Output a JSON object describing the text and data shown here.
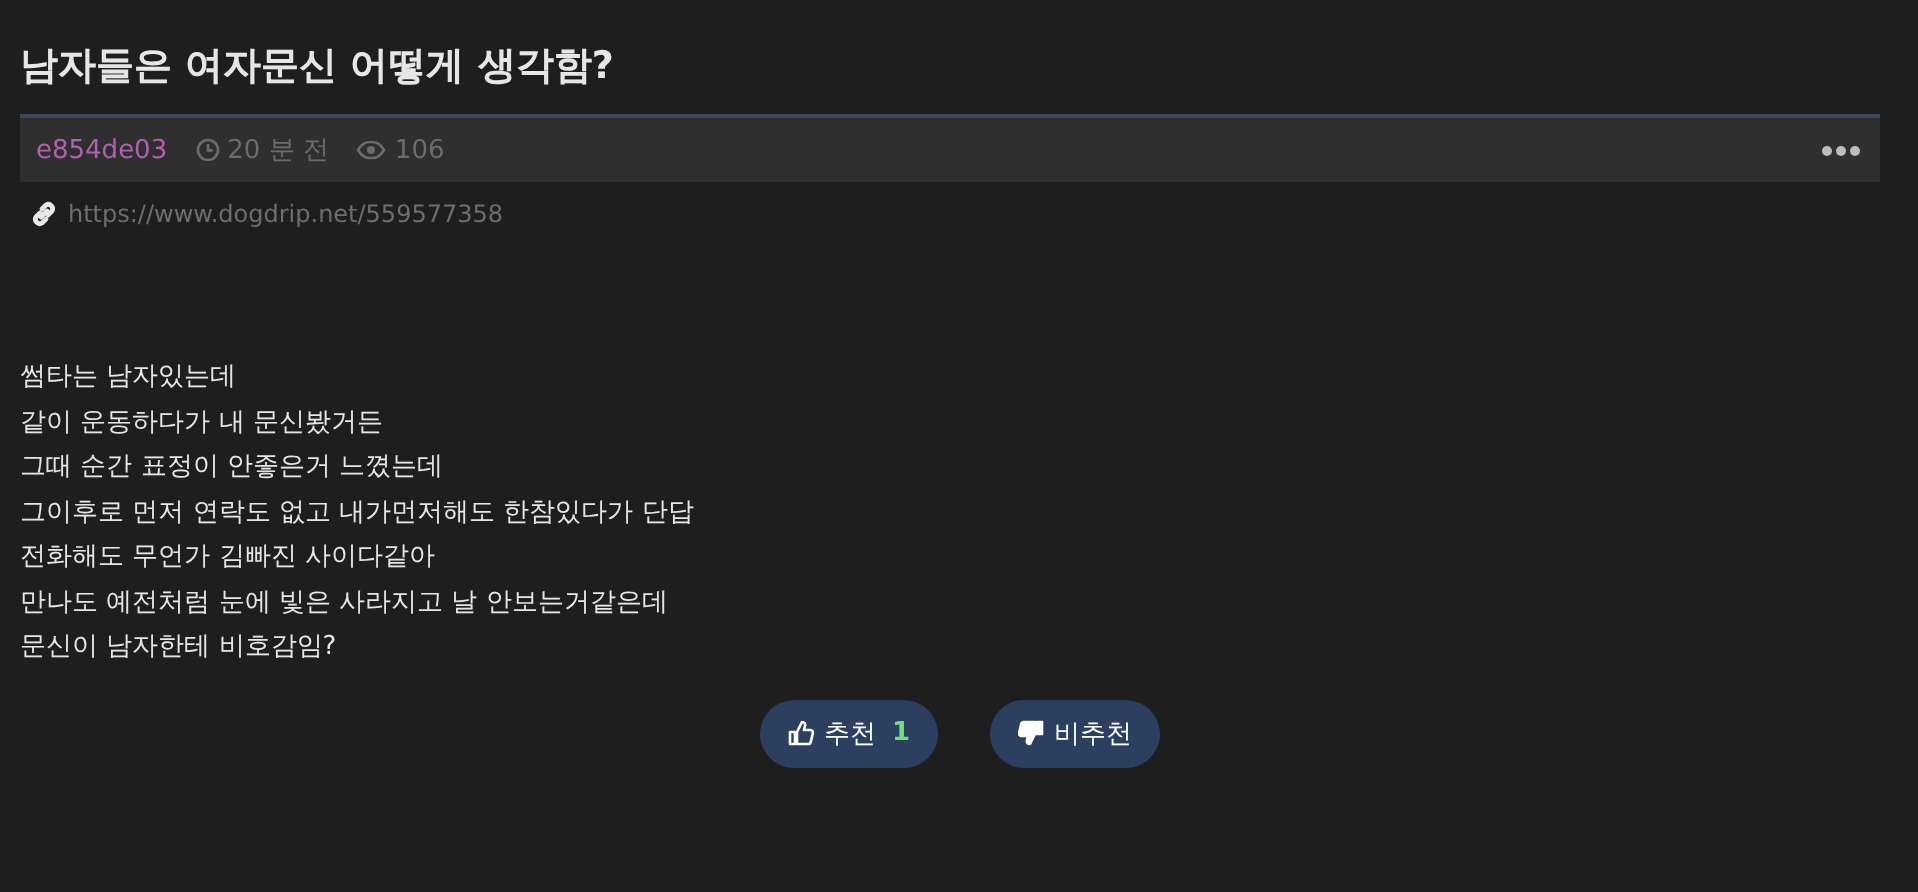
{
  "post": {
    "title": "남자들은 여자문신 어떻게 생각함?",
    "author": "e854de03",
    "time": "20 분 전",
    "views": "106",
    "url": "https://www.dogdrip.net/559577358",
    "body": [
      "썸타는 남자있는데",
      "같이 운동하다가 내 문신봤거든",
      "그때 순간 표정이 안좋은거 느꼈는데",
      "그이후로 먼저 연락도 없고 내가먼저해도 한참있다가 단답",
      "전화해도 무언가 김빠진 사이다같아",
      "만나도 예전처럼 눈에 빛은 사라지고 날 안보는거같은데",
      "문신이 남자한테 비호감임?"
    ]
  },
  "votes": [
    {
      "kind": "up",
      "label": "추천",
      "count": "1"
    },
    {
      "kind": "down",
      "label": "비추천"
    }
  ]
}
